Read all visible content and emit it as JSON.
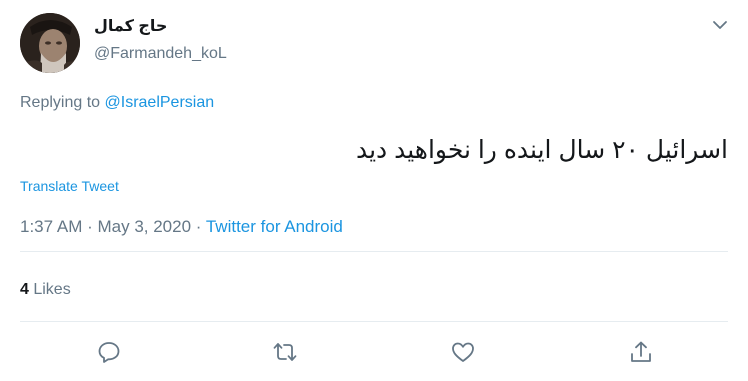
{
  "author": {
    "display_name": "حاج کمال",
    "handle": "@Farmandeh_koL"
  },
  "reply": {
    "prefix": "Replying to ",
    "mention": "@IsraelPersian"
  },
  "tweet": {
    "text": "اسرائیل ۲۰ سال اینده را نخواهید دید",
    "translate_label": "Translate Tweet"
  },
  "meta": {
    "time": "1:37 AM",
    "sep1": " · ",
    "date": "May 3, 2020",
    "sep2": " · ",
    "source": "Twitter for Android"
  },
  "stats": {
    "likes_count": "4",
    "likes_label": " Likes"
  },
  "actions": [
    "reply-icon",
    "retweet-icon",
    "like-icon",
    "share-icon"
  ],
  "colors": {
    "link": "#1b95e0",
    "secondary_text": "#657786",
    "primary_text": "#14171a",
    "divider": "#e6ecf0"
  }
}
